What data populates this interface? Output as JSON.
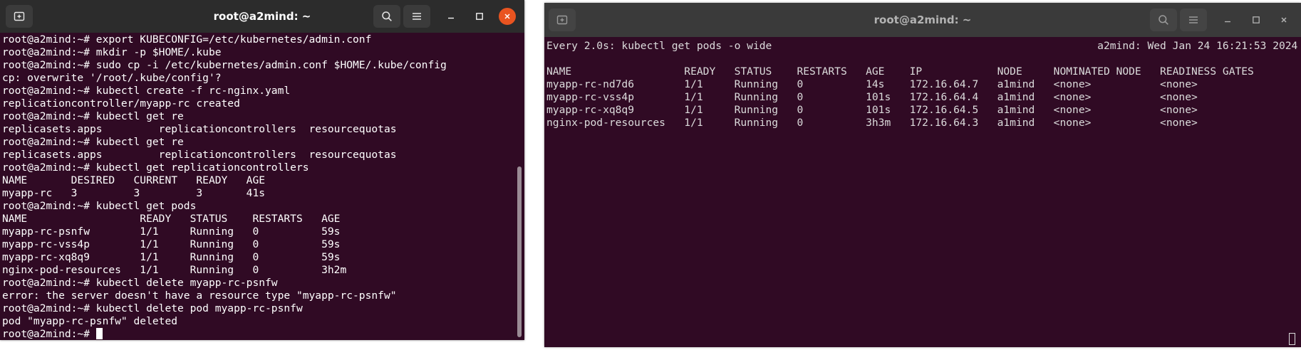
{
  "left_window": {
    "title": "root@a2mind: ~",
    "icons": {
      "new_tab": "new-tab-icon",
      "search": "search-icon",
      "menu": "hamburger-menu-icon",
      "minimize": "minimize-icon",
      "maximize": "maximize-icon",
      "close": "close-icon"
    },
    "lines": [
      "root@a2mind:~# export KUBECONFIG=/etc/kubernetes/admin.conf",
      "root@a2mind:~# mkdir -p $HOME/.kube",
      "root@a2mind:~# sudo cp -i /etc/kubernetes/admin.conf $HOME/.kube/config",
      "cp: overwrite '/root/.kube/config'?",
      "root@a2mind:~# kubectl create -f rc-nginx.yaml",
      "replicationcontroller/myapp-rc created",
      "root@a2mind:~# kubectl get re",
      "replicasets.apps         replicationcontrollers  resourcequotas",
      "root@a2mind:~# kubectl get re",
      "replicasets.apps         replicationcontrollers  resourcequotas",
      "root@a2mind:~# kubectl get replicationcontrollers",
      "NAME       DESIRED   CURRENT   READY   AGE",
      "myapp-rc   3         3         3       41s",
      "root@a2mind:~# kubectl get pods",
      "NAME                  READY   STATUS    RESTARTS   AGE",
      "myapp-rc-psnfw        1/1     Running   0          59s",
      "myapp-rc-vss4p        1/1     Running   0          59s",
      "myapp-rc-xq8q9        1/1     Running   0          59s",
      "nginx-pod-resources   1/1     Running   0          3h2m",
      "root@a2mind:~# kubectl delete myapp-rc-psnfw",
      "error: the server doesn't have a resource type \"myapp-rc-psnfw\"",
      "root@a2mind:~# kubectl delete pod myapp-rc-psnfw",
      "pod \"myapp-rc-psnfw\" deleted"
    ],
    "prompt": "root@a2mind:~# "
  },
  "right_window": {
    "title": "root@a2mind: ~",
    "icons": {
      "new_tab": "new-tab-icon",
      "search": "search-icon",
      "menu": "hamburger-menu-icon",
      "minimize": "minimize-icon",
      "maximize": "maximize-icon",
      "close": "close-icon"
    },
    "watch_header": "Every 2.0s: kubectl get pods -o wide                                                    a2mind: Wed Jan 24 16:21:53 2024",
    "lines": [
      "",
      "NAME                  READY   STATUS    RESTARTS   AGE    IP            NODE     NOMINATED NODE   READINESS GATES",
      "myapp-rc-nd7d6        1/1     Running   0          14s    172.16.64.7   a1mind   <none>           <none>",
      "myapp-rc-vss4p        1/1     Running   0          101s   172.16.64.4   a1mind   <none>           <none>",
      "myapp-rc-xq8q9        1/1     Running   0          101s   172.16.64.5   a1mind   <none>           <none>",
      "nginx-pod-resources   1/1     Running   0          3h3m   172.16.64.3   a1mind   <none>           <none>"
    ]
  }
}
